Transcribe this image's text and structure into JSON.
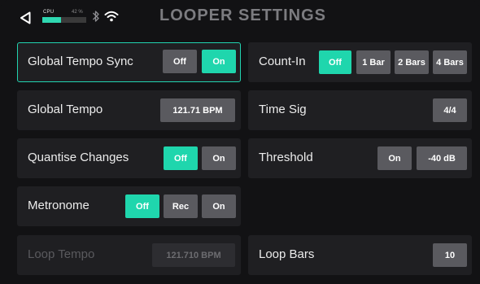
{
  "status_bar": {
    "back_icon": "back-arrow-icon",
    "cpu_label": "CPU",
    "cpu_percent_text": "42 %",
    "cpu_load": 0.42,
    "bluetooth_icon": "bluetooth-icon",
    "wifi_icon": "wifi-icon"
  },
  "page_title": "LOOPER SETTINGS",
  "colors": {
    "accent": "#1fd6ad",
    "button": "#5a5a5f",
    "tile": "#1f1f22",
    "background": "#121214"
  },
  "settings": {
    "global_tempo_sync": {
      "label": "Global Tempo Sync",
      "off": "Off",
      "on": "On",
      "selected": "On"
    },
    "count_in": {
      "label": "Count-In",
      "off": "Off",
      "bar1": "1 Bar",
      "bars2": "2 Bars",
      "bars4": "4 Bars",
      "selected": "Off"
    },
    "global_tempo": {
      "label": "Global Tempo",
      "value": "121.71 BPM"
    },
    "time_sig": {
      "label": "Time Sig",
      "value": "4/4"
    },
    "quantise_changes": {
      "label": "Quantise Changes",
      "off": "Off",
      "on": "On",
      "selected": "Off"
    },
    "threshold": {
      "label": "Threshold",
      "on": "On",
      "value": "-40 dB"
    },
    "metronome": {
      "label": "Metronome",
      "off": "Off",
      "rec": "Rec",
      "on": "On",
      "selected": "Off"
    },
    "loop_tempo": {
      "label": "Loop Tempo",
      "value": "121.710 BPM"
    },
    "loop_bars": {
      "label": "Loop Bars",
      "value": "10"
    }
  }
}
